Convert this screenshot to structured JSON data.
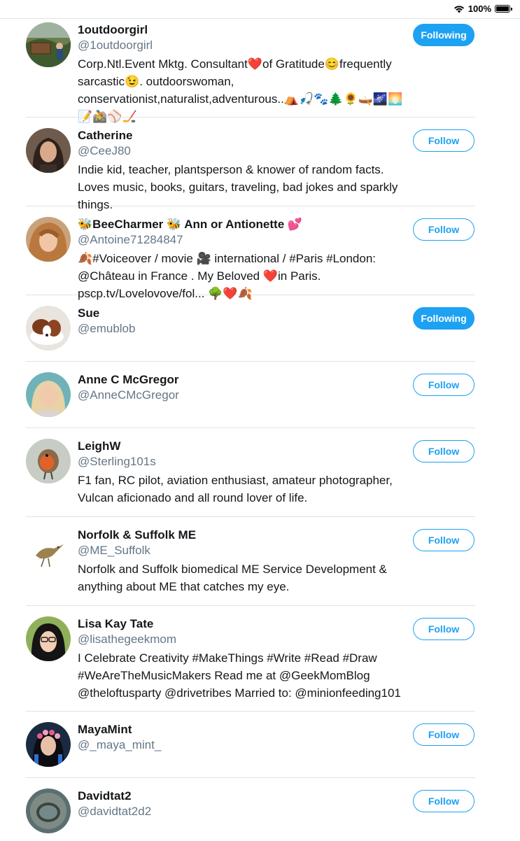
{
  "status_bar": {
    "battery_text": "100%"
  },
  "colors": {
    "accent": "#1da1f2",
    "handle": "#657786",
    "divider": "#dfe3e6"
  },
  "users": [
    {
      "name": "1outdoorgirl",
      "handle": "@1outdoorgirl",
      "bio": "Corp.Ntl.Event Mktg. Consultant❤️of Gratitude😊frequently sarcastic😉. outdoorswoman, conservationist,naturalist,adventurous..⛺🎣🐾🌲🌻🛶🌌🌅📝🚵⚾🏒",
      "button": "Following",
      "state": "following",
      "avatar": "yellowstone-sign-photo"
    },
    {
      "name": "Catherine",
      "handle": "@CeeJ80",
      "bio": "Indie kid, teacher, plantsperson & knower of random facts. Loves music, books, guitars, traveling, bad jokes and sparkly things.",
      "button": "Follow",
      "state": "follow",
      "avatar": "woman-portrait"
    },
    {
      "name": "🐝BeeCharmer 🐝 Ann or Antionette 💕",
      "handle": "@Antoine71284847",
      "bio": "🍂#Voiceover / movie 🎥 international / #Paris #London: @Château in France . My Beloved ❤️in Paris. pscp.tv/Lovelovove/fol... 🌳❤️🍂",
      "button": "Follow",
      "state": "follow",
      "avatar": "woman-portrait"
    },
    {
      "name": "Sue",
      "handle": "@emublob",
      "bio": "",
      "button": "Following",
      "state": "following",
      "avatar": "spaniel-dog"
    },
    {
      "name": "Anne C McGregor",
      "handle": "@AnneCMcGregor",
      "bio": "",
      "button": "Follow",
      "state": "follow",
      "avatar": "woman-portrait"
    },
    {
      "name": "LeighW",
      "handle": "@Sterling101s",
      "bio": "F1 fan, RC pilot, aviation enthusiast, amateur photographer, Vulcan aficionado and all round lover of life.",
      "button": "Follow",
      "state": "follow",
      "avatar": "robin-bird"
    },
    {
      "name": "Norfolk & Suffolk ME",
      "handle": "@ME_Suffolk",
      "bio": "Norfolk and Suffolk biomedical ME Service Development & anything about ME that catches my eye.",
      "button": "Follow",
      "state": "follow",
      "avatar": "bittern-bird-drawing"
    },
    {
      "name": "Lisa Kay Tate",
      "handle": "@lisathegeekmom",
      "bio": "I Celebrate Creativity #MakeThings #Write #Read #Draw #WeAreTheMusicMakers Read me at @GeekMomBlog @theloftusparty @drivetribes Married to: @minionfeeding101",
      "button": "Follow",
      "state": "follow",
      "avatar": "woman-glasses-portrait"
    },
    {
      "name": "MayaMint",
      "handle": "@_maya_mint_",
      "bio": "",
      "button": "Follow",
      "state": "follow",
      "avatar": "flower-crown-portrait"
    },
    {
      "name": "Davidtat2",
      "handle": "@davidtat2d2",
      "bio": "",
      "button": "Follow",
      "state": "follow",
      "avatar": "man-helmet-portrait"
    }
  ]
}
